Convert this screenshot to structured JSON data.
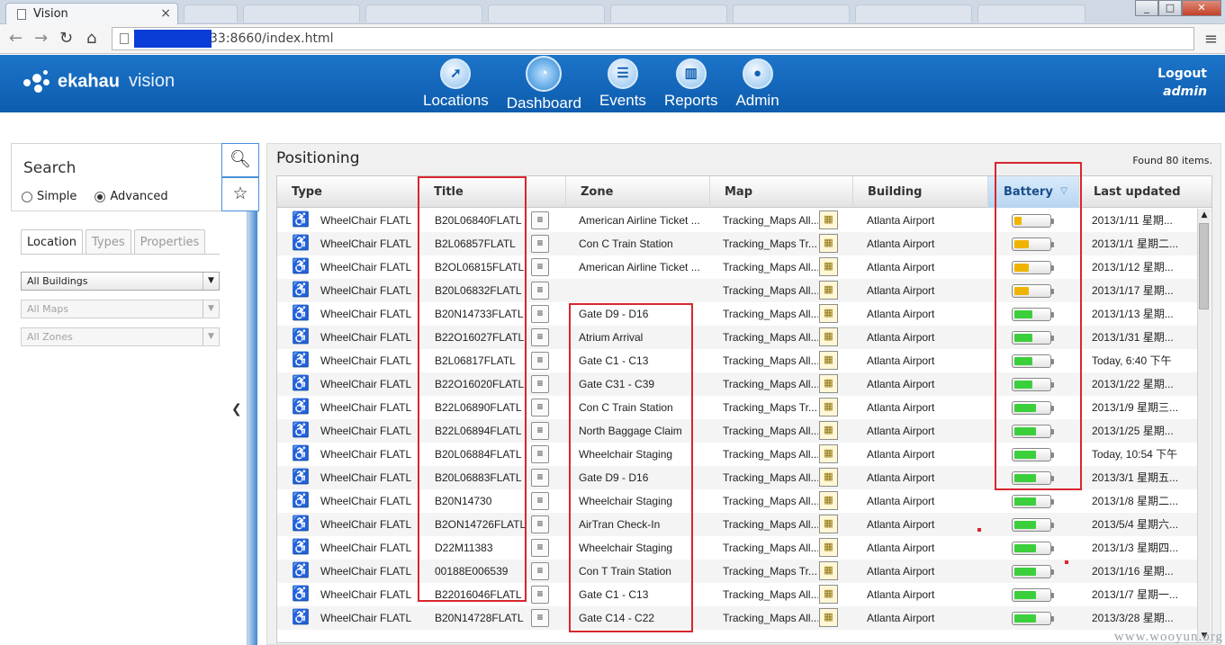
{
  "browser": {
    "tab_title": "Vision",
    "tab_close": "×",
    "url_suffix": "33:8660/index.html"
  },
  "app": {
    "logo_name": "ekahau",
    "logo_product": "vision",
    "nav": [
      {
        "label": "Locations",
        "icon": "locations-icon"
      },
      {
        "label": "Dashboard",
        "icon": "dashboard-icon"
      },
      {
        "label": "Events",
        "icon": "events-icon"
      },
      {
        "label": "Reports",
        "icon": "reports-icon"
      },
      {
        "label": "Admin",
        "icon": "admin-icon"
      }
    ],
    "active_nav": "Dashboard",
    "logout_label": "Logout",
    "user": "admin"
  },
  "search": {
    "label": "Search",
    "mode_simple": "Simple",
    "mode_advanced": "Advanced",
    "selected_mode": "Advanced",
    "tabs": [
      "Location",
      "Types",
      "Properties"
    ],
    "active_tab": "Location",
    "building_select": "All Buildings",
    "maps_select": "All Maps",
    "zones_select": "All Zones"
  },
  "positioning": {
    "title": "Positioning",
    "found": "Found 80 items.",
    "columns": [
      "Type",
      "Title",
      "Zone",
      "Map",
      "Building",
      "Battery",
      "Last updated"
    ],
    "sorted_column": "Battery",
    "rows": [
      {
        "type": "WheelChair FLATL",
        "title": "B20L06840FLATL",
        "zone": "American Airline Ticket ...",
        "map": "Tracking_Maps All...",
        "building": "Atlanta Airport",
        "battery": 0.2,
        "battery_color": "#f0b400",
        "updated": "2013/1/11 星期..."
      },
      {
        "type": "WheelChair FLATL",
        "title": "B2L06857FLATL",
        "zone": "Con C Train Station",
        "map": "Tracking_Maps Tr...",
        "building": "Atlanta Airport",
        "battery": 0.4,
        "battery_color": "#f0b400",
        "updated": "2013/1/1 星期二..."
      },
      {
        "type": "WheelChair FLATL",
        "title": "B2OL06815FLATL",
        "zone": "American Airline Ticket ...",
        "map": "Tracking_Maps All...",
        "building": "Atlanta Airport",
        "battery": 0.4,
        "battery_color": "#f0b400",
        "updated": "2013/1/12 星期..."
      },
      {
        "type": "WheelChair FLATL",
        "title": "B20L06832FLATL",
        "zone": "",
        "map": "Tracking_Maps All...",
        "building": "Atlanta Airport",
        "battery": 0.4,
        "battery_color": "#f0b400",
        "updated": "2013/1/17 星期..."
      },
      {
        "type": "WheelChair FLATL",
        "title": "B20N14733FLATL",
        "zone": "Gate D9 - D16",
        "map": "Tracking_Maps All...",
        "building": "Atlanta Airport",
        "battery": 0.5,
        "battery_color": "#3ccf3c",
        "updated": "2013/1/13 星期..."
      },
      {
        "type": "WheelChair FLATL",
        "title": "B22O16027FLATL",
        "zone": "Atrium Arrival",
        "map": "Tracking_Maps All...",
        "building": "Atlanta Airport",
        "battery": 0.5,
        "battery_color": "#3ccf3c",
        "updated": "2013/1/31 星期..."
      },
      {
        "type": "WheelChair FLATL",
        "title": "B2L06817FLATL",
        "zone": "Gate C1 - C13",
        "map": "Tracking_Maps All...",
        "building": "Atlanta Airport",
        "battery": 0.5,
        "battery_color": "#3ccf3c",
        "updated": "Today, 6:40 下午"
      },
      {
        "type": "WheelChair FLATL",
        "title": "B22O16020FLATL",
        "zone": "Gate C31 - C39",
        "map": "Tracking_Maps All...",
        "building": "Atlanta Airport",
        "battery": 0.5,
        "battery_color": "#3ccf3c",
        "updated": "2013/1/22 星期..."
      },
      {
        "type": "WheelChair FLATL",
        "title": "B22L06890FLATL",
        "zone": "Con C Train Station",
        "map": "Tracking_Maps Tr...",
        "building": "Atlanta Airport",
        "battery": 0.6,
        "battery_color": "#3ccf3c",
        "updated": "2013/1/9 星期三..."
      },
      {
        "type": "WheelChair FLATL",
        "title": "B22L06894FLATL",
        "zone": "North Baggage Claim",
        "map": "Tracking_Maps All...",
        "building": "Atlanta Airport",
        "battery": 0.6,
        "battery_color": "#3ccf3c",
        "updated": "2013/1/25 星期..."
      },
      {
        "type": "WheelChair FLATL",
        "title": "B20L06884FLATL",
        "zone": "Wheelchair Staging",
        "map": "Tracking_Maps All...",
        "building": "Atlanta Airport",
        "battery": 0.6,
        "battery_color": "#3ccf3c",
        "updated": "Today, 10:54 下午"
      },
      {
        "type": "WheelChair FLATL",
        "title": "B20L06883FLATL",
        "zone": "Gate D9 - D16",
        "map": "Tracking_Maps All...",
        "building": "Atlanta Airport",
        "battery": 0.6,
        "battery_color": "#3ccf3c",
        "updated": "2013/3/1 星期五..."
      },
      {
        "type": "WheelChair FLATL",
        "title": "B20N14730",
        "zone": "Wheelchair Staging",
        "map": "Tracking_Maps All...",
        "building": "Atlanta Airport",
        "battery": 0.6,
        "battery_color": "#3ccf3c",
        "updated": "2013/1/8 星期二..."
      },
      {
        "type": "WheelChair FLATL",
        "title": "B2ON14726FLATL",
        "zone": "AirTran Check-In",
        "map": "Tracking_Maps All...",
        "building": "Atlanta Airport",
        "battery": 0.6,
        "battery_color": "#3ccf3c",
        "updated": "2013/5/4 星期六..."
      },
      {
        "type": "WheelChair FLATL",
        "title": "D22M11383",
        "zone": "Wheelchair Staging",
        "map": "Tracking_Maps All...",
        "building": "Atlanta Airport",
        "battery": 0.6,
        "battery_color": "#3ccf3c",
        "updated": "2013/1/3 星期四..."
      },
      {
        "type": "WheelChair FLATL",
        "title": "00188E006539",
        "zone": "Con T Train Station",
        "map": "Tracking_Maps Tr...",
        "building": "Atlanta Airport",
        "battery": 0.6,
        "battery_color": "#3ccf3c",
        "updated": "2013/1/16 星期..."
      },
      {
        "type": "WheelChair FLATL",
        "title": "B22016046FLATL",
        "zone": "Gate C1 - C13",
        "map": "Tracking_Maps All...",
        "building": "Atlanta Airport",
        "battery": 0.6,
        "battery_color": "#3ccf3c",
        "updated": "2013/1/7 星期一..."
      },
      {
        "type": "WheelChair FLATL",
        "title": "B20N14728FLATL",
        "zone": "Gate C14 - C22",
        "map": "Tracking_Maps All...",
        "building": "Atlanta Airport",
        "battery": 0.6,
        "battery_color": "#3ccf3c",
        "updated": "2013/3/28 星期..."
      }
    ]
  },
  "watermark": "www.wooyun.org",
  "colors": {
    "header_blue": "#1668bd",
    "annotation_red": "#d8262e",
    "battery_low": "#f0b400",
    "battery_ok": "#3ccf3c"
  }
}
